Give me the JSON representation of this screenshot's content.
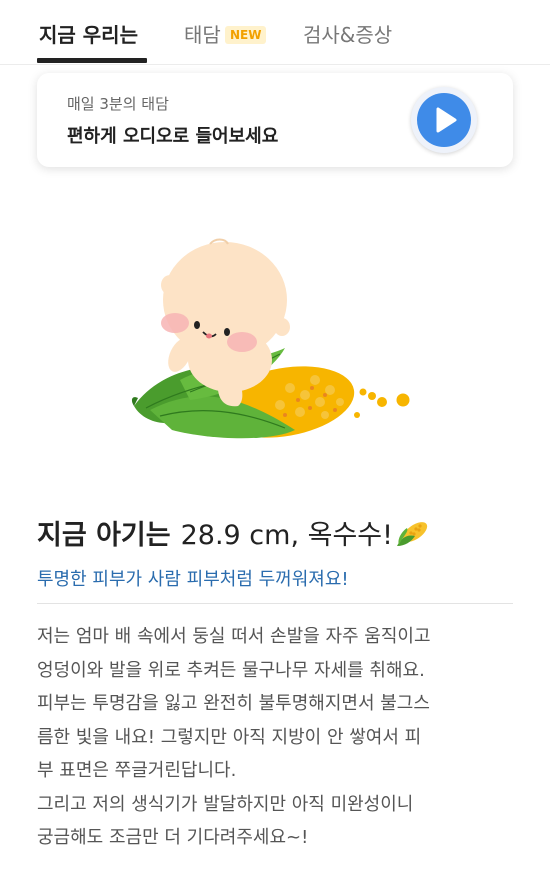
{
  "tabs": {
    "now": "지금 우리는",
    "taedam": "태담",
    "taedam_badge": "NEW",
    "check": "검사&증상"
  },
  "audio": {
    "subtitle": "매일 3분의 태담",
    "title": "편하게 오디오로 들어보세요",
    "play_icon": "play-icon"
  },
  "baby": {
    "headline_bold": "지금 아기는",
    "size": "28.9 cm, 옥수수!",
    "emoji_icon": "corn-icon",
    "subtitle": "투명한 피부가 사람 피부처럼 두꺼워져요!",
    "body_lines": [
      "저는 엄마 배 속에서 둥실 떠서 손발을 자주 움직이고",
      "엉덩이와 발을 위로 추켜든 물구나무 자세를 취해요.",
      "피부는 투명감을 잃고 완전히 불투명해지면서 불그스",
      "름한 빛을 내요! 그렇지만 아직 지방이 안 쌓여서 피",
      "부 표면은 쭈글거린답니다.",
      "그리고 저의 생식기가 발달하지만 아직 미완성이니",
      "궁금해도 조금만 더 기다려주세요~!"
    ]
  },
  "colors": {
    "accent_blue": "#3f8be8",
    "subtitle_blue": "#2a6cae",
    "badge_orange": "#f2a100"
  }
}
